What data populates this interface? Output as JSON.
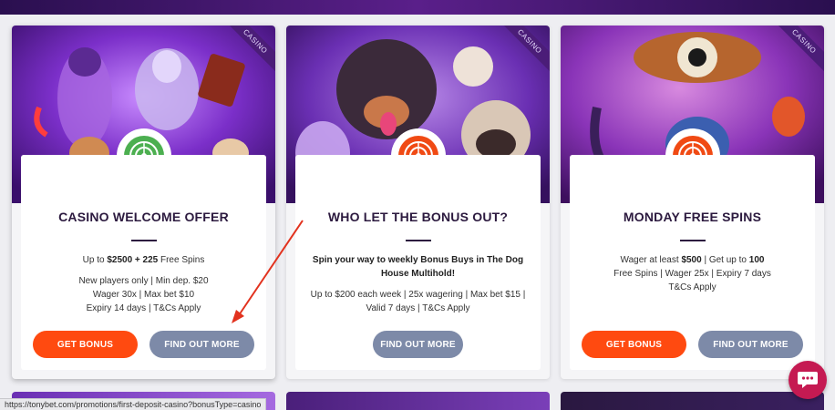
{
  "cards": [
    {
      "ribbon": "CASINO",
      "title": "CASINO WELCOME OFFER",
      "line1_pre": "Up to ",
      "line1_bold": "$2500 + 225",
      "line1_post": " Free Spins",
      "line2": "New players only | Min dep. $20",
      "line3": "Wager 30x | Max bet $10",
      "line4": "Expiry 14 days | T&Cs Apply",
      "primary_button": "GET BONUS",
      "secondary_button": "FIND OUT MORE",
      "badge_color": "#4caf50"
    },
    {
      "ribbon": "CASINO",
      "title": "WHO LET THE BONUS OUT?",
      "bold_text": "Spin your way to weekly Bonus Buys in The Dog House Multihold!",
      "body_text": "Up to $200 each week | 25x wagering | Max bet $15 | Valid 7 days | T&Cs Apply",
      "secondary_button": "FIND OUT MORE",
      "badge_color": "#f04a14"
    },
    {
      "ribbon": "CASINO",
      "title": "MONDAY FREE SPINS",
      "l1_pre": "Wager at least ",
      "l1_bold": "$500",
      "l1_mid": " | Get up to ",
      "l1_bold2": "100",
      "l2": "Free Spins | Wager 25x | Expiry 7 days",
      "l3": "T&Cs Apply",
      "primary_button": "GET BONUS",
      "secondary_button": "FIND OUT MORE",
      "badge_color": "#f04a14"
    }
  ],
  "status_url": "https://tonybet.com/promotions/first-deposit-casino?bonusType=casino",
  "colors": {
    "accent_orange": "#ff4a10",
    "button_gray": "#7d8aa8",
    "title_dark": "#2c1a3f",
    "arrow_red": "#e2321e",
    "chat_bg": "#c51a52"
  }
}
